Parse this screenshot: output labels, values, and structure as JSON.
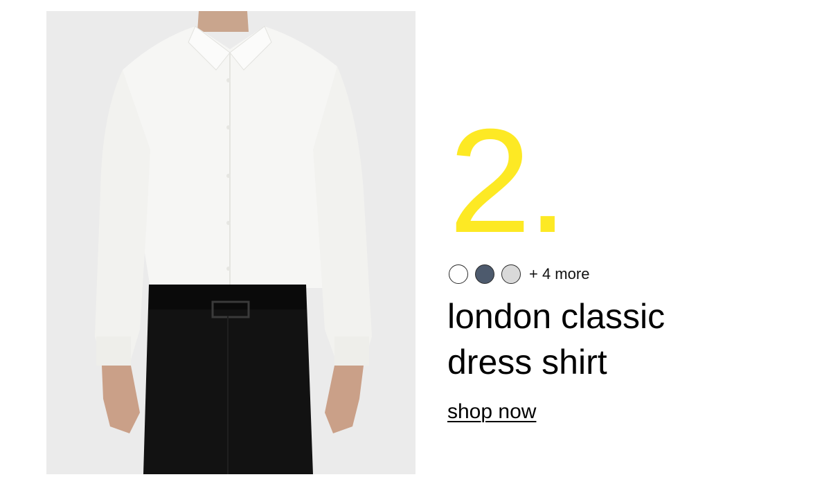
{
  "product": {
    "rank": "2.",
    "more_colors": "+ 4 more",
    "title_line1": "london classic",
    "title_line2": "dress shirt",
    "cta": "shop now",
    "swatches": [
      {
        "name": "white",
        "color": "#ffffff"
      },
      {
        "name": "navy",
        "color": "#4d5a6d"
      },
      {
        "name": "light-grey",
        "color": "#d9d9d9"
      }
    ]
  },
  "colors": {
    "accent": "#fde924",
    "text": "#000000",
    "photo_bg": "#ebebeb"
  }
}
